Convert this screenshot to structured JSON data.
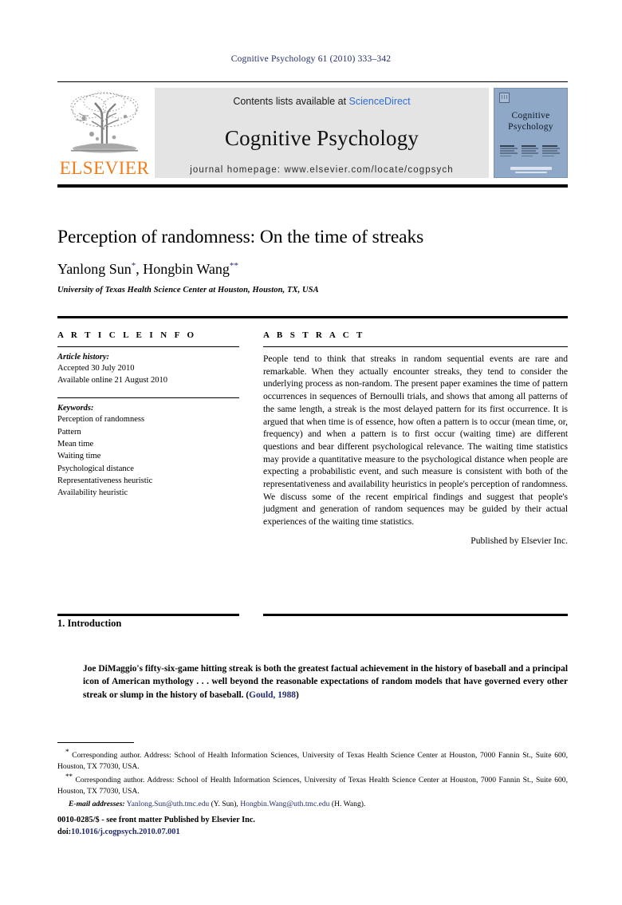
{
  "running_head": "Cognitive Psychology 61 (2010) 333–342",
  "masthead": {
    "contents_prefix": "Contents lists available at ",
    "sciencedirect": "ScienceDirect",
    "journal_name": "Cognitive Psychology",
    "homepage": "journal homepage: www.elsevier.com/locate/cogpsych",
    "publisher_wordmark": "ELSEVIER",
    "cover": {
      "title_line1": "Cognitive",
      "title_line2": "Psychology"
    },
    "colors": {
      "banner_bg": "#e4e4e4",
      "sciencedirect_blue": "#2f6fd0",
      "elsevier_orange": "#f07c1a",
      "cover_blue": "#8fa8c8",
      "link_navy": "#232c6b"
    }
  },
  "article": {
    "title": "Perception of randomness: On the time of streaks",
    "authors": [
      {
        "name": "Yanlong Sun",
        "marker": "*"
      },
      {
        "name": "Hongbin Wang",
        "marker": "**"
      }
    ],
    "authors_plain": "Yanlong Sun *, Hongbin Wang **",
    "affiliation": "University of Texas Health Science Center at Houston, Houston, TX, USA"
  },
  "info": {
    "heading": "A R T I C L E   I N F O",
    "history_label": "Article history:",
    "history": [
      "Accepted 30 July 2010",
      "Available online 21 August 2010"
    ],
    "keywords_label": "Keywords:",
    "keywords": [
      "Perception of randomness",
      "Pattern",
      "Mean time",
      "Waiting time",
      "Psychological distance",
      "Representativeness heuristic",
      "Availability heuristic"
    ]
  },
  "abstract": {
    "heading": "A B S T R A C T",
    "text": "People tend to think that streaks in random sequential events are rare and remarkable. When they actually encounter streaks, they tend to consider the underlying process as non-random. The present paper examines the time of pattern occurrences in sequences of Bernoulli trials, and shows that among all patterns of the same length, a streak is the most delayed pattern for its first occurrence. It is argued that when time is of essence, how often a pattern is to occur (mean time, or, frequency) and when a pattern is to first occur (waiting time) are different questions and bear different psychological relevance. The waiting time statistics may provide a quantitative measure to the psychological distance when people are expecting a probabilistic event, and such measure is consistent with both of the representativeness and availability heuristics in people's perception of randomness. We discuss some of the recent empirical findings and suggest that people's judgment and generation of random sequences may be guided by their actual experiences of the waiting time statistics.",
    "publisher_line": "Published by Elsevier Inc."
  },
  "introduction": {
    "heading": "1. Introduction",
    "epigraph_part1": "Joe DiMaggio's fifty-six-game hitting streak is both the greatest factual achievement in the history of baseball and a principal icon of American mythology . . . well beyond the reasonable expectations of random models that have governed every other streak or slump in the history of baseball. (",
    "epigraph_citation": "Gould, 1988",
    "epigraph_part2": ")"
  },
  "footnotes": {
    "note1_marker": "*",
    "note1": " Corresponding author. Address: School of Health Information Sciences, University of Texas Health Science Center at Houston, 7000 Fannin St., Suite 600, Houston, TX 77030, USA.",
    "note2_marker": "**",
    "note2": " Corresponding author. Address: School of Health Information Sciences, University of Texas Health Science Center at Houston, 7000 Fannin St., Suite 600, Houston, TX 77030, USA.",
    "email_label": "E-mail addresses:",
    "email1": "Yanlong.Sun@uth.tmc.edu",
    "email1_owner": " (Y. Sun), ",
    "email2": "Hongbin.Wang@uth.tmc.edu",
    "email2_owner": " (H. Wang)."
  },
  "colophon": {
    "issn_line": "0010-0285/$ - see front matter Published by Elsevier Inc.",
    "doi_prefix": "doi:",
    "doi": "10.1016/j.cogpsych.2010.07.001"
  }
}
